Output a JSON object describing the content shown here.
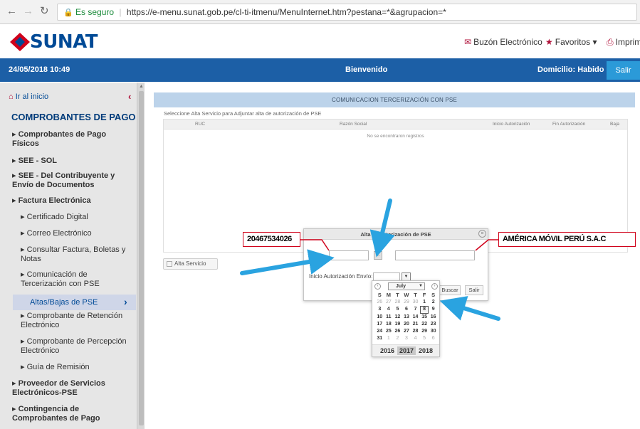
{
  "browser": {
    "secure_label": "Es seguro",
    "url": "https://e-menu.sunat.gob.pe/cl-ti-itmenu/MenuInternet.htm?pestana=*&agrupacion=*"
  },
  "header": {
    "brand": "SUNAT",
    "mailbox": "Buzón Electrónico",
    "favorites": "Favoritos",
    "print": "Imprimi"
  },
  "topbar": {
    "datetime": "24/05/2018 10:49",
    "welcome": "Bienvenido",
    "domicile": "Domicilio: Habido",
    "exit": "Salir"
  },
  "sidebar": {
    "home": "Ir al inicio",
    "title": "COMPROBANTES DE PAGO",
    "items": [
      {
        "label": "Comprobantes de Pago Físicos"
      },
      {
        "label": "SEE - SOL"
      },
      {
        "label": "SEE - Del Contribuyente y Envío de Documentos"
      },
      {
        "label": "Factura Electrónica"
      },
      {
        "label": "Certificado Digital"
      },
      {
        "label": "Correo Electrónico"
      },
      {
        "label": "Consultar Factura, Boletas y Notas"
      },
      {
        "label": "Comunicación de Tercerización con PSE"
      },
      {
        "label": "Altas/Bajas de PSE"
      },
      {
        "label": "Comprobante de Retención Electrónico"
      },
      {
        "label": "Comprobante de Percepción Electrónico"
      },
      {
        "label": "Guía de Remisión"
      },
      {
        "label": "Proveedor de Servicios Electrónicos-PSE"
      },
      {
        "label": "Contingencia de Comprobantes de Pago"
      }
    ]
  },
  "main": {
    "title": "COMUNICACION TERCERIZACIÓN CON PSE",
    "instruction": "Seleccione Alta Servicio para Adjuntar alta de autorización de PSE",
    "columns": [
      "RUC",
      "Razón Social",
      "Inicio Autorización",
      "Fin Autorización",
      "Baja"
    ],
    "empty": "No se encontraron registros",
    "alta_button": "Alta Servicio"
  },
  "modal": {
    "title": "Alta de autorización de PSE",
    "ruc_label": "RUC",
    "inicio_label": "Inicio Autorización Envío:",
    "buscar": "Buscar",
    "salir": "Salir"
  },
  "calendar": {
    "month": "July",
    "weekdays": [
      "S",
      "M",
      "T",
      "W",
      "T",
      "F",
      "S"
    ],
    "weeks": [
      [
        "26",
        "27",
        "28",
        "29",
        "30",
        "1",
        "2"
      ],
      [
        "3",
        "4",
        "5",
        "6",
        "7",
        "8",
        "9"
      ],
      [
        "10",
        "11",
        "12",
        "13",
        "14",
        "15",
        "16"
      ],
      [
        "17",
        "18",
        "19",
        "20",
        "21",
        "22",
        "23"
      ],
      [
        "24",
        "25",
        "26",
        "27",
        "28",
        "29",
        "30"
      ],
      [
        "31",
        "1",
        "2",
        "3",
        "4",
        "5",
        "6"
      ]
    ],
    "years": [
      "2016",
      "2017",
      "2018"
    ]
  },
  "annotations": {
    "ruc_value": "20467534026",
    "company_value": "AMÉRICA MÓVIL PERÚ S.A.C"
  },
  "colors": {
    "brand_blue": "#1c5fa6",
    "accent_red": "#d0021b",
    "arrow_blue": "#2aa3e0"
  }
}
